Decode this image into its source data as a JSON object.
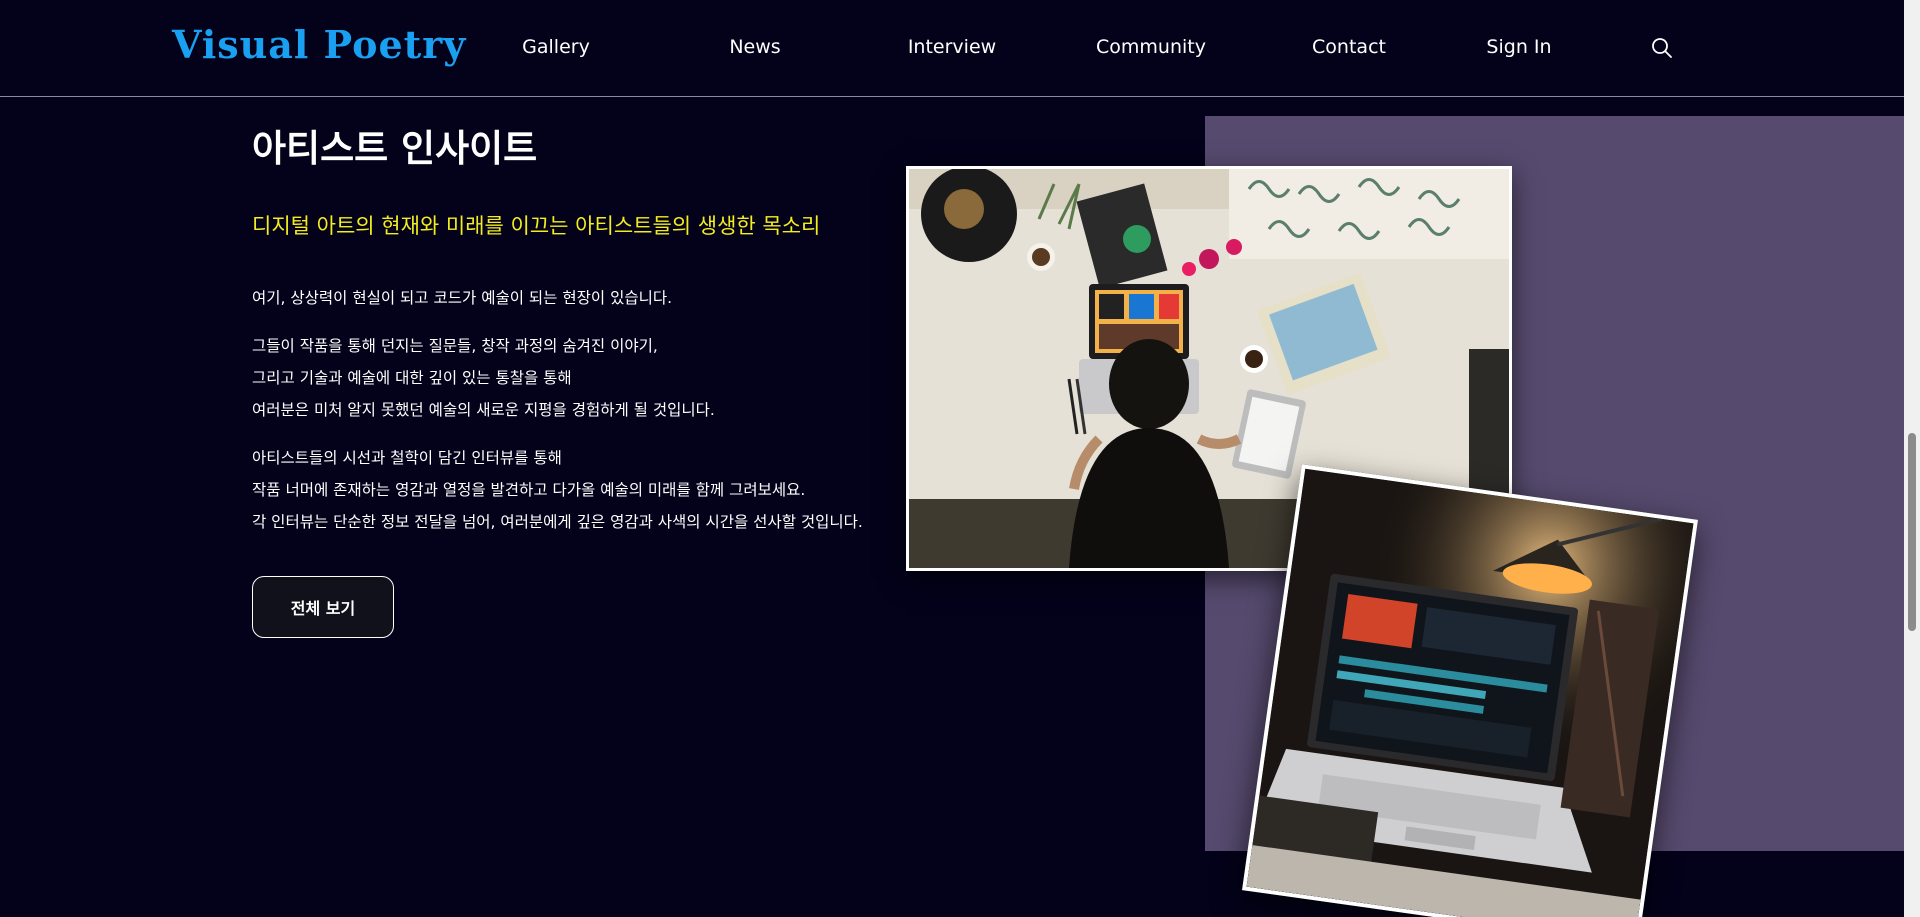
{
  "header": {
    "logo": "Visual Poetry",
    "nav": [
      "Gallery",
      "News",
      "Interview",
      "Community",
      "Contact",
      "Sign In"
    ]
  },
  "section": {
    "title": "아티스트 인사이트",
    "subtitle": "디지털 아트의 현재와 미래를 이끄는 아티스트들의 생생한 목소리",
    "paragraphs": [
      "여기, 상상력이 현실이 되고 코드가 예술이 되는 현장이 있습니다.",
      "그들이 작품을 통해 던지는 질문들, 창작 과정의 숨겨진 이야기,",
      "그리고 기술과 예술에 대한 깊이 있는 통찰을 통해",
      "여러분은 미처 알지 못했던 예술의 새로운 지평을 경험하게 될 것입니다.",
      "아티스트들의 시선과 철학이 담긴 인터뷰를 통해",
      "작품 너머에 존재하는 영감과 열정을 발견하고 다가올 예술의 미래를 함께 그려보세요.",
      "각 인터뷰는 단순한 정보 전달을 넘어, 여러분에게 깊은 영감과 사색의 시간을 선사할 것입니다."
    ],
    "button_label": "전체 보기"
  },
  "colors": {
    "background": "#03021a",
    "logo": "#1aa0f0",
    "subtitle": "#f3ec1f",
    "panel": "#564a6e"
  },
  "icons": {
    "search": "search-icon"
  }
}
